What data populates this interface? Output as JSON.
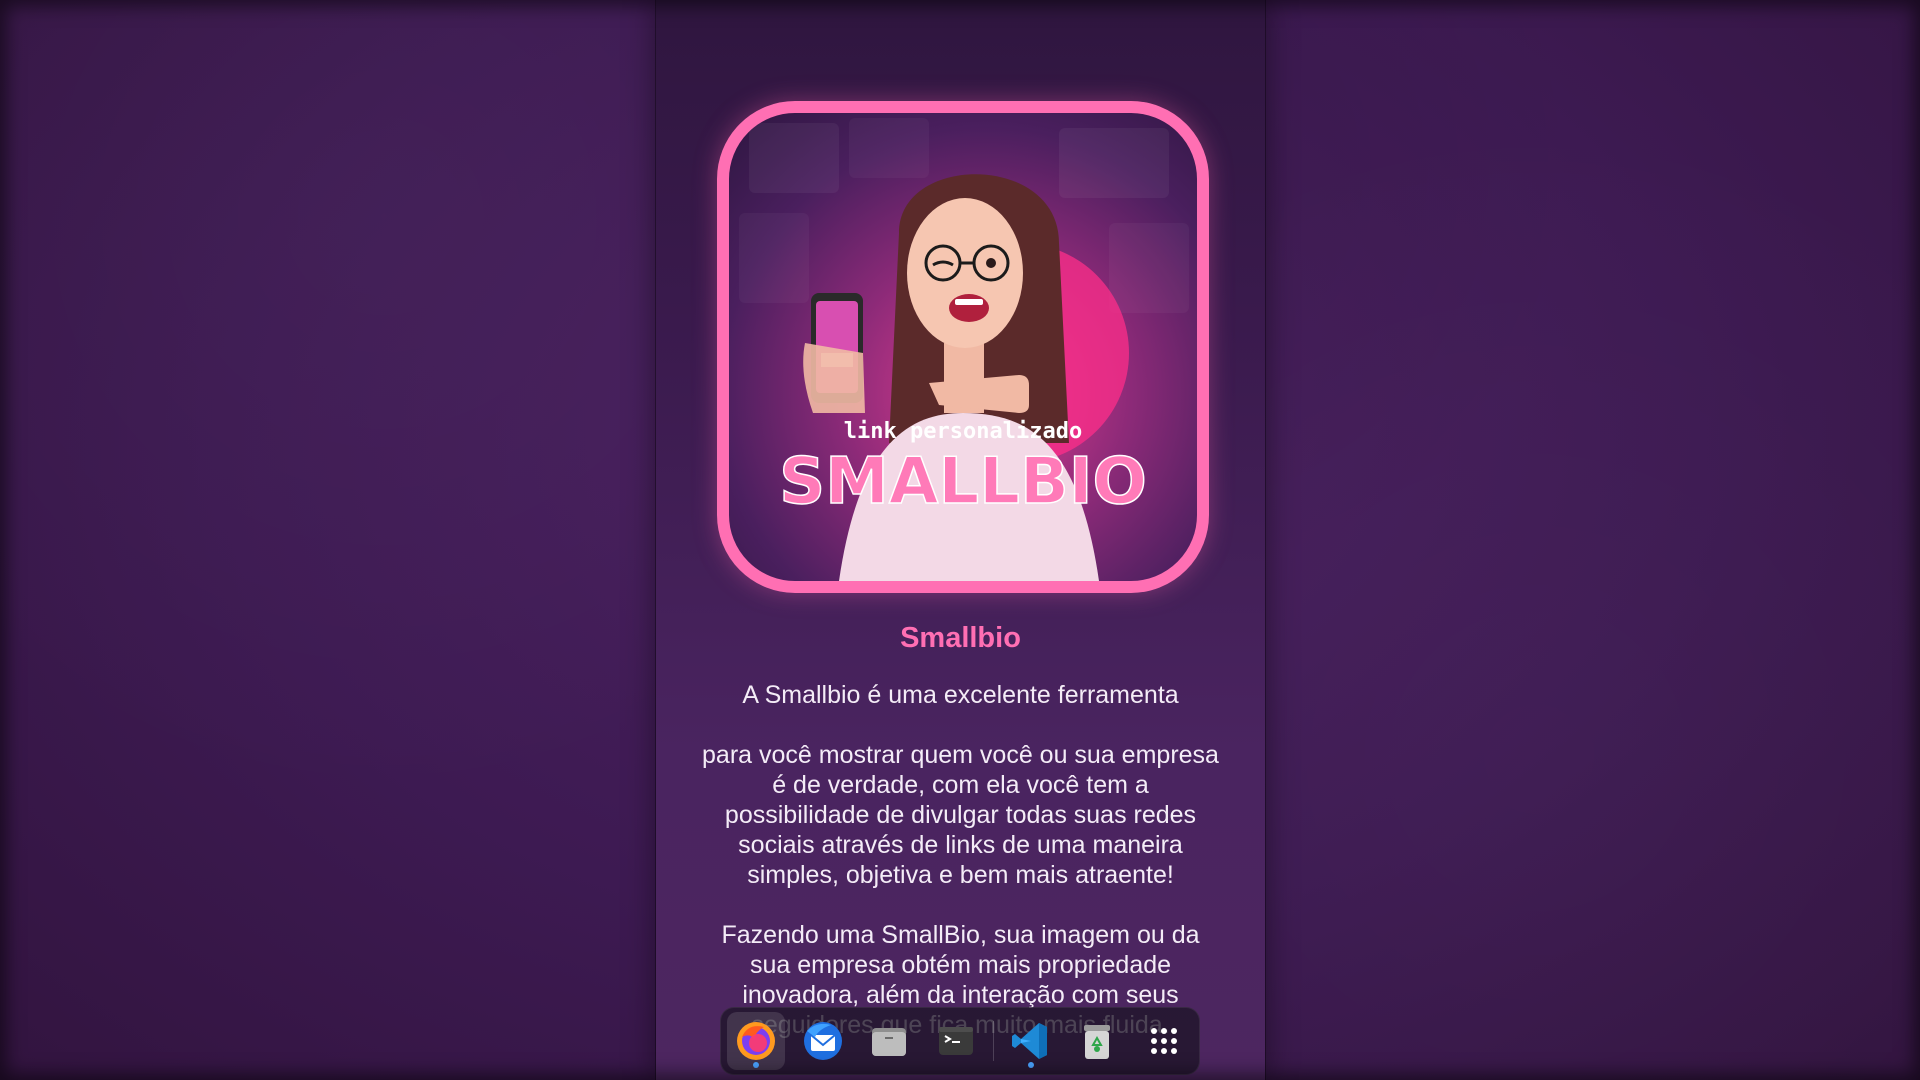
{
  "profile": {
    "name": "Smallbio",
    "avatar_text_top": "link personalizado",
    "avatar_text_main": "SMALLBIO",
    "bio_paragraphs": [
      "A Smallbio é uma excelente ferramenta",
      "para você mostrar quem você ou sua empresa é de verdade, com ela você tem a possibilidade de divulgar todas suas redes sociais através de links de uma maneira simples, objetiva e bem mais atraente!",
      "Fazendo uma SmallBio, sua imagem ou da sua empresa obtém mais propriedade inovadora, além da interação com seus seguidores que fica muito mais fluida."
    ]
  },
  "colors": {
    "accent": "#ff6fb3",
    "panel_bg": "#3a1a4d",
    "page_bg": "#3d1a52"
  },
  "dock": {
    "items": [
      {
        "name": "firefox-icon",
        "active": true
      },
      {
        "name": "thunderbird-icon",
        "active": false
      },
      {
        "name": "files-icon",
        "active": false
      },
      {
        "name": "terminal-icon",
        "active": false
      },
      {
        "name": "vscode-icon",
        "active": true
      },
      {
        "name": "trash-icon",
        "active": false
      },
      {
        "name": "app-grid-icon",
        "active": false
      }
    ]
  }
}
